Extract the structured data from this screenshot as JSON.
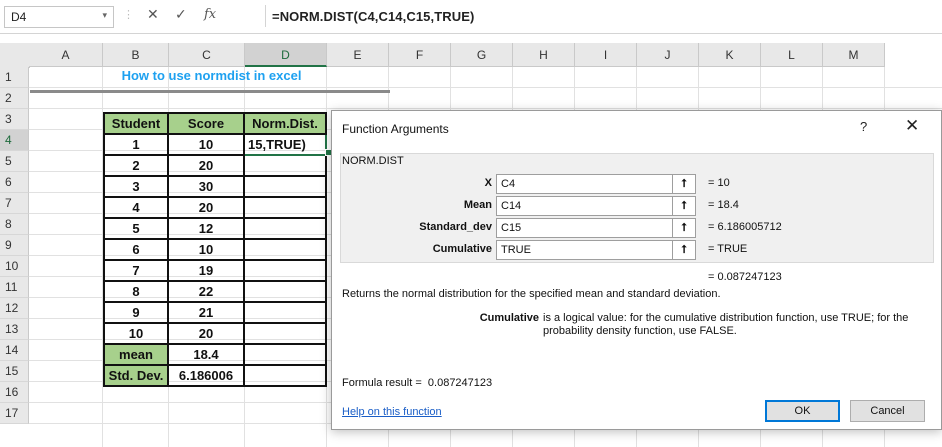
{
  "formula_bar": {
    "name_box": "D4",
    "dropdown_glyph": "▾",
    "separator_glyph": "⋮",
    "cancel_glyph": "✕",
    "enter_glyph": "✓",
    "fx_glyph": "fx",
    "formula": "=NORM.DIST(C4,C14,C15,TRUE)"
  },
  "columns": [
    "A",
    "B",
    "C",
    "D",
    "E",
    "F",
    "G",
    "H",
    "I",
    "J",
    "K",
    "L",
    "M"
  ],
  "rows": [
    "1",
    "2",
    "3",
    "4",
    "5",
    "6",
    "7",
    "8",
    "9",
    "10",
    "11",
    "12",
    "13",
    "14",
    "15",
    "16",
    "17"
  ],
  "sheet_title": "How to use normdist in excel",
  "table": {
    "headers": [
      "Student",
      "Score",
      "Norm.Dist."
    ],
    "rows": [
      {
        "student": "1",
        "score": "10",
        "norm": "15,TRUE)"
      },
      {
        "student": "2",
        "score": "20",
        "norm": ""
      },
      {
        "student": "3",
        "score": "30",
        "norm": ""
      },
      {
        "student": "4",
        "score": "20",
        "norm": ""
      },
      {
        "student": "5",
        "score": "12",
        "norm": ""
      },
      {
        "student": "6",
        "score": "10",
        "norm": ""
      },
      {
        "student": "7",
        "score": "19",
        "norm": ""
      },
      {
        "student": "8",
        "score": "22",
        "norm": ""
      },
      {
        "student": "9",
        "score": "21",
        "norm": ""
      },
      {
        "student": "10",
        "score": "20",
        "norm": ""
      }
    ],
    "mean_label": "mean",
    "mean_value": "18.4",
    "sd_label": "Std. Dev.",
    "sd_value": "6.186006"
  },
  "dialog": {
    "title": "Function Arguments",
    "help_glyph": "?",
    "close_glyph": "✕",
    "function_name": "NORM.DIST",
    "ref_glyph": "⭡",
    "args": [
      {
        "label": "X",
        "input": "C4",
        "value": "=  10"
      },
      {
        "label": "Mean",
        "input": "C14",
        "value": "=  18.4"
      },
      {
        "label": "Standard_dev",
        "input": "C15",
        "value": "=  6.186005712"
      },
      {
        "label": "Cumulative",
        "input": "TRUE",
        "value": "=  TRUE"
      }
    ],
    "result": "=  0.087247123",
    "description": "Returns the normal distribution for the specified mean and standard deviation.",
    "param_name": "Cumulative",
    "param_description": "is a logical value: for the cumulative distribution function, use TRUE; for the probability density function, use FALSE.",
    "formula_result_label": "Formula result =",
    "formula_result": "0.087247123",
    "help_link": "Help on this function",
    "ok_label": "OK",
    "cancel_label": "Cancel"
  },
  "colors": {
    "header_green": "#a7d08c",
    "accent_green": "#217346",
    "title_blue": "#1ea1f0",
    "link_blue": "#1a5ec7"
  }
}
